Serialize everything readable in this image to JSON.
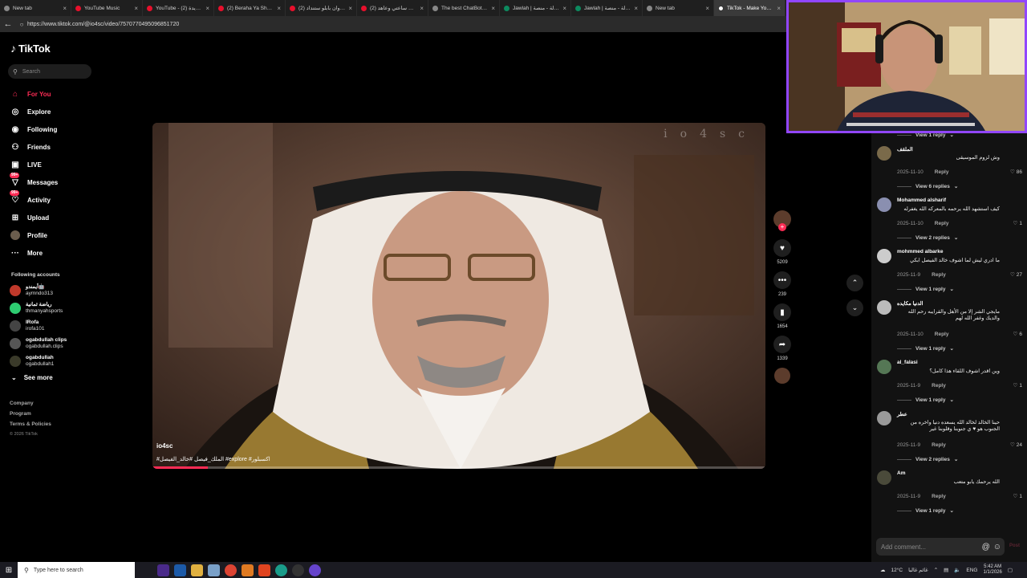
{
  "browser": {
    "tabs": [
      {
        "title": "New tab",
        "icon": "newtab-icon",
        "active": false
      },
      {
        "title": "YouTube Music",
        "icon": "youtube-music-icon",
        "active": false
      },
      {
        "title": "YouTube - سنة جديدة (2)",
        "icon": "youtube-icon",
        "active": false
      },
      {
        "title": "(2) Beraha Ya Sheekha",
        "icon": "youtube-icon",
        "active": false
      },
      {
        "title": "(2) مروان بابلو ستنداد -",
        "icon": "youtube-icon",
        "active": false
      },
      {
        "title": "(2) وليدت ساعتي وعاهد",
        "icon": "youtube-icon",
        "active": false
      },
      {
        "title": "The best ChatBot and",
        "icon": "chatbot-icon",
        "active": false
      },
      {
        "title": "Jawlah | جولة - منصة",
        "icon": "jawlah-icon",
        "active": false
      },
      {
        "title": "Jawlah | جولة - منصة",
        "icon": "jawlah-icon",
        "active": false
      },
      {
        "title": "New tab",
        "icon": "newtab-icon",
        "active": false
      },
      {
        "title": "TikTok - Make Your Da",
        "icon": "tiktok-icon",
        "active": true
      }
    ],
    "url": "https://www.tiktok.com/@io4sc/video/7570770495096851720"
  },
  "tiktok": {
    "logo_text": "TikTok",
    "search_placeholder": "Search",
    "nav": [
      {
        "label": "For You",
        "icon": "home-icon",
        "active": true
      },
      {
        "label": "Explore",
        "icon": "compass-icon"
      },
      {
        "label": "Following",
        "icon": "following-icon"
      },
      {
        "label": "Friends",
        "icon": "friends-icon"
      },
      {
        "label": "LIVE",
        "icon": "live-icon"
      },
      {
        "label": "Messages",
        "icon": "messages-icon",
        "badge": "99+"
      },
      {
        "label": "Activity",
        "icon": "activity-icon",
        "badge": "99+"
      },
      {
        "label": "Upload",
        "icon": "upload-icon"
      },
      {
        "label": "Profile",
        "icon": "profile-avatar"
      },
      {
        "label": "More",
        "icon": "more-icon"
      }
    ],
    "following_header": "Following accounts",
    "following": [
      {
        "name": "أيمندو🤖",
        "handle": "aymndo313",
        "color": "#c0392b"
      },
      {
        "name": "رياضة ثمانية",
        "handle": "thmanyahsports",
        "color": "#2ecc71"
      },
      {
        "name": "IRofa",
        "handle": "irofa101",
        "color": "#444444"
      },
      {
        "name": "ogabdullah clips",
        "handle": "ogabdullah.clips",
        "color": "#555555"
      },
      {
        "name": "ogabdullah",
        "handle": "ogabdullah1",
        "color": "#3a3a2a"
      }
    ],
    "see_more": "See more",
    "footer": [
      "Company",
      "Program",
      "Terms & Policies"
    ],
    "copyright": "© 2026 TikTok"
  },
  "video": {
    "watermark": "io4sc",
    "author": "io4sc",
    "caption": "#الملك_فيصل #خالد_الفيصل #explore #اكسبلور",
    "progress_fraction": 0.09
  },
  "actions": {
    "likes": "5209",
    "comments": "239",
    "saves": "1654",
    "shares": "1339"
  },
  "comments": {
    "top_view_replies": "View 1 reply",
    "items": [
      {
        "name": "الملقف",
        "text": "وش لزوم الموسيقى",
        "date": "2025-11-10",
        "likes": "86",
        "replies": "View 6 replies",
        "avatar_color": "#7a6a4a"
      },
      {
        "name": "Mohammed alsharif",
        "text": "كيف استشهد الله يرحمه بالمعركه الله يغفرله",
        "date": "2025-11-10",
        "likes": "1",
        "replies": "View 2 replies",
        "avatar_color": "#8a8fb0"
      },
      {
        "name": "mohmmed albarke",
        "text": "ما ادري ليش لما اشوف خالد الفيصل ابكي",
        "date": "2025-11-9",
        "likes": "27",
        "replies": "View 1 reply",
        "avatar_color": "#cccccc"
      },
      {
        "name": "الدنيا مكايده",
        "text": "مايجي الشر إلا من الأهل والقرايبه رحم الله والديك وغفر الله لهم",
        "date": "2025-11-10",
        "likes": "6",
        "replies": "View 1 reply",
        "avatar_color": "#bbbbbb"
      },
      {
        "name": "al_falasi",
        "text": "وين اقدر اشوف اللقاء هذا كامل؟",
        "date": "2025-11-9",
        "likes": "1",
        "replies": "View 1 reply",
        "avatar_color": "#557755"
      },
      {
        "name": "عطر",
        "text": "حينا الخالد لخالد الله يسعده دنيا واخره من الجنوب هو ♥ ي جنوبنا وقلوبنا غير",
        "date": "2025-11-9",
        "likes": "24",
        "replies": "View 2 replies",
        "avatar_color": "#999999"
      },
      {
        "name": "Am",
        "text": "الله يرحمك يابو متعب",
        "date": "2025-11-9",
        "likes": "1",
        "replies": "View 1 reply",
        "avatar_color": "#4a4a3a"
      }
    ],
    "reply_label": "Reply",
    "add_placeholder": "Add comment...",
    "post_label": "Post"
  },
  "taskbar": {
    "search_placeholder": "Type here to search",
    "weather": "12°C",
    "weather_text": "غائم غالبا",
    "lang": "ENG",
    "time": "5:42 AM",
    "date": "1/1/2026"
  },
  "colors": {
    "accent": "#fe2c55",
    "webcam_border": "#9146ff"
  }
}
